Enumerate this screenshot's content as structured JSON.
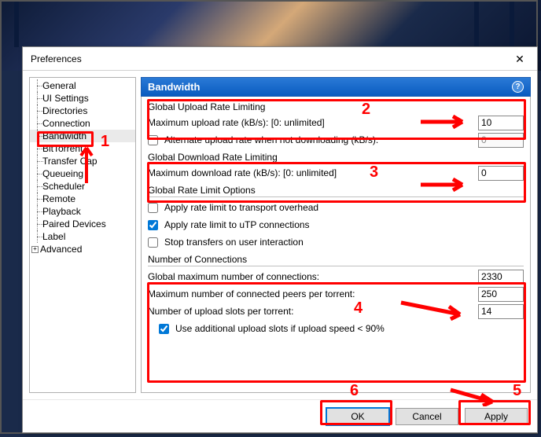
{
  "dialog": {
    "title": "Preferences"
  },
  "tree": {
    "items": [
      "General",
      "UI Settings",
      "Directories",
      "Connection",
      "Bandwidth",
      "BitTorrent",
      "Transfer Cap",
      "Queueing",
      "Scheduler",
      "Remote",
      "Playback",
      "Paired Devices",
      "Label",
      "Advanced"
    ]
  },
  "header": {
    "title": "Bandwidth"
  },
  "upload": {
    "title": "Global Upload Rate Limiting",
    "max_label": "Maximum upload rate (kB/s): [0: unlimited]",
    "max_value": "10",
    "alt_label": "Alternate upload rate when not downloading (kB/s):",
    "alt_value": "0"
  },
  "download": {
    "title": "Global Download Rate Limiting",
    "max_label": "Maximum download rate (kB/s): [0: unlimited]",
    "max_value": "0"
  },
  "options": {
    "title": "Global Rate Limit Options",
    "overhead": "Apply rate limit to transport overhead",
    "utp": "Apply rate limit to uTP connections",
    "stop": "Stop transfers on user interaction"
  },
  "conns": {
    "title": "Number of Connections",
    "global_label": "Global maximum number of connections:",
    "global_value": "2330",
    "peers_label": "Maximum number of connected peers per torrent:",
    "peers_value": "250",
    "slots_label": "Number of upload slots per torrent:",
    "slots_value": "14",
    "extra_label": "Use additional upload slots if upload speed < 90%"
  },
  "buttons": {
    "ok": "OK",
    "cancel": "Cancel",
    "apply": "Apply"
  },
  "annotations": {
    "n1": "1",
    "n2": "2",
    "n3": "3",
    "n4": "4",
    "n5": "5",
    "n6": "6"
  }
}
